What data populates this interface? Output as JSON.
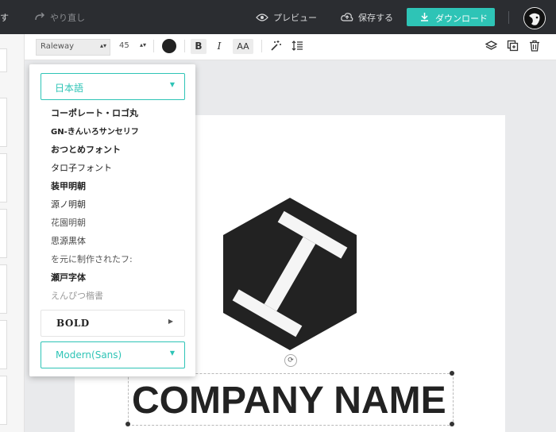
{
  "topbar": {
    "left_fragment": "す",
    "redo": "やり直し",
    "preview": "プレビュー",
    "save": "保存する",
    "download": "ダウンロード"
  },
  "toolbar": {
    "font_value": "Raleway",
    "size_value": "45",
    "text_color": "#222222",
    "bold_label": "B",
    "italic_label": "I",
    "case_label": "AA"
  },
  "font_panel": {
    "language": "日本語",
    "fonts": [
      "コーポレート・ロゴ丸",
      "GN-きんいろサンセリフ",
      "おつとめフォント",
      "タロ子フォント",
      "装甲明朝",
      "源ノ明朝",
      "花園明朝",
      "思源黒体",
      "を元に制作されたフ:",
      "瀬戸字体",
      "えんぴつ楷書"
    ],
    "category": "BOLD",
    "style": "Modern(Sans)"
  },
  "canvas": {
    "company_name": "COMPANY NAME"
  },
  "colors": {
    "accent": "#2ec4b6",
    "topbar": "#2b2d31"
  }
}
